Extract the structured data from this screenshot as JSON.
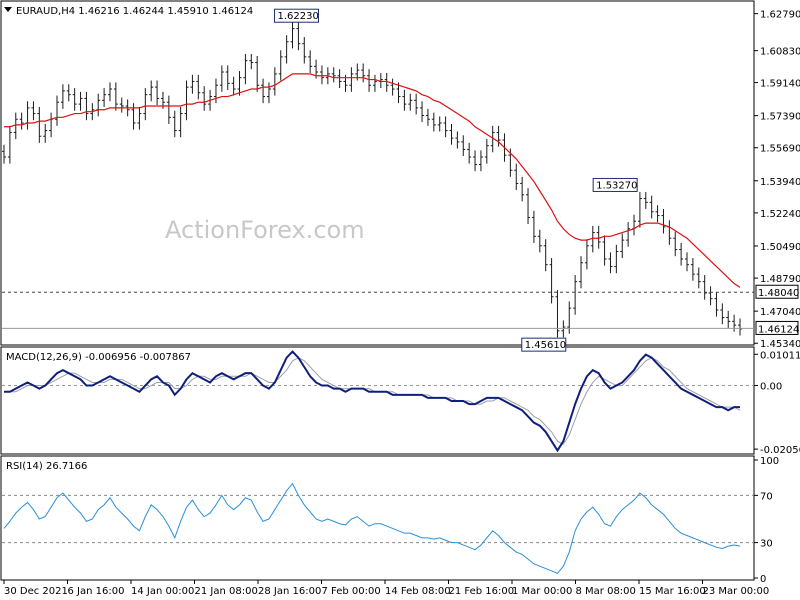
{
  "chart_data": [
    {
      "type": "candlestick",
      "header": "EURAUD,H4  1.46216 1.46244 1.45910 1.46124",
      "symbol": "EURAUD",
      "timeframe": "H4",
      "last_ohlc": {
        "open": 1.46216,
        "high": 1.46244,
        "low": 1.4591,
        "close": 1.46124
      },
      "watermark": "ActionForex.com",
      "ylim": [
        1.453,
        1.633
      ],
      "y_ticks": [
        "1.62790",
        "1.60830",
        "1.59140",
        "1.57390",
        "1.55690",
        "1.53940",
        "1.52240",
        "1.50490",
        "1.48790",
        "1.47040",
        "1.45340"
      ],
      "price_tags": [
        {
          "label": "1.48040",
          "value": 1.4804,
          "style": "dashed"
        },
        {
          "label": "1.46124",
          "value": 1.46124,
          "style": "solid"
        }
      ],
      "annotations": [
        {
          "label": "1.62230",
          "value": 1.6223,
          "x_fraction": 0.43
        },
        {
          "label": "1.53270",
          "value": 1.5327,
          "x_fraction": 0.863
        },
        {
          "label": "1.45610",
          "value": 1.4561,
          "x_fraction": 0.766
        }
      ],
      "close_series": [
        1.552,
        1.565,
        1.572,
        1.57,
        1.578,
        1.575,
        1.563,
        1.566,
        1.572,
        1.581,
        1.587,
        1.585,
        1.58,
        1.583,
        1.575,
        1.577,
        1.582,
        1.585,
        1.588,
        1.58,
        1.579,
        1.577,
        1.57,
        1.575,
        1.585,
        1.589,
        1.583,
        1.581,
        1.573,
        1.566,
        1.575,
        1.589,
        1.592,
        1.586,
        1.58,
        1.584,
        1.59,
        1.597,
        1.591,
        1.588,
        1.594,
        1.603,
        1.602,
        1.59,
        1.584,
        1.588,
        1.596,
        1.605,
        1.613,
        1.62,
        1.612,
        1.605,
        1.6,
        1.597,
        1.594,
        1.596,
        1.595,
        1.592,
        1.59,
        1.596,
        1.598,
        1.595,
        1.59,
        1.592,
        1.593,
        1.59,
        1.588,
        1.584,
        1.58,
        1.582,
        1.578,
        1.574,
        1.572,
        1.569,
        1.57,
        1.566,
        1.562,
        1.56,
        1.556,
        1.552,
        1.548,
        1.552,
        1.558,
        1.565,
        1.561,
        1.553,
        1.545,
        1.538,
        1.532,
        1.52,
        1.51,
        1.505,
        1.495,
        1.478,
        1.46,
        1.462,
        1.472,
        1.486,
        1.496,
        1.505,
        1.512,
        1.507,
        1.498,
        1.494,
        1.502,
        1.508,
        1.514,
        1.518,
        1.53,
        1.528,
        1.523,
        1.521,
        1.515,
        1.509,
        1.503,
        1.498,
        1.495,
        1.49,
        1.486,
        1.48,
        1.477,
        1.471,
        1.467,
        1.465,
        1.463,
        1.461
      ],
      "ma_series": [
        1.568,
        1.568,
        1.569,
        1.569,
        1.57,
        1.57,
        1.571,
        1.571,
        1.572,
        1.573,
        1.573,
        1.574,
        1.575,
        1.575,
        1.576,
        1.576,
        1.577,
        1.577,
        1.578,
        1.578,
        1.578,
        1.578,
        1.578,
        1.578,
        1.579,
        1.579,
        1.579,
        1.579,
        1.579,
        1.579,
        1.579,
        1.58,
        1.58,
        1.581,
        1.581,
        1.582,
        1.583,
        1.584,
        1.584,
        1.585,
        1.586,
        1.587,
        1.588,
        1.588,
        1.589,
        1.589,
        1.59,
        1.592,
        1.594,
        1.596,
        1.596,
        1.596,
        1.596,
        1.595,
        1.595,
        1.595,
        1.594,
        1.594,
        1.594,
        1.594,
        1.594,
        1.594,
        1.593,
        1.593,
        1.592,
        1.592,
        1.591,
        1.59,
        1.589,
        1.588,
        1.587,
        1.585,
        1.584,
        1.582,
        1.581,
        1.579,
        1.577,
        1.575,
        1.573,
        1.571,
        1.568,
        1.566,
        1.564,
        1.562,
        1.56,
        1.557,
        1.554,
        1.551,
        1.547,
        1.543,
        1.539,
        1.534,
        1.529,
        1.524,
        1.518,
        1.514,
        1.511,
        1.509,
        1.508,
        1.508,
        1.509,
        1.509,
        1.51,
        1.51,
        1.511,
        1.512,
        1.513,
        1.514,
        1.516,
        1.517,
        1.517,
        1.517,
        1.516,
        1.515,
        1.513,
        1.511,
        1.509,
        1.506,
        1.503,
        1.5,
        1.497,
        1.494,
        1.491,
        1.488,
        1.485,
        1.483
      ],
      "x_tick_labels": [
        "30 Dec 2021",
        "6 Jan 16:00",
        "14 Jan 00:00",
        "21 Jan 08:00",
        "28 Jan 16:00",
        "7 Feb 00:00",
        "14 Feb 08:00",
        "21 Feb 16:00",
        "1 Mar 00:00",
        "8 Mar 08:00",
        "15 Mar 16:00",
        "23 Mar 00:00"
      ],
      "grid": false
    },
    {
      "type": "line",
      "header": "MACD(12,26,9) -0.006956 -0.007867",
      "name": "MACD(12,26,9)",
      "last_values": [
        -0.006956,
        -0.007867
      ],
      "y_ticks": [
        "0.010113",
        "0.00",
        "-0.020561"
      ],
      "ylim": [
        -0.0215,
        0.0115
      ],
      "macd_series": [
        -0.002,
        -0.002,
        -0.001,
        0.0,
        0.001,
        0.0,
        -0.001,
        0.0,
        0.002,
        0.004,
        0.005,
        0.004,
        0.003,
        0.002,
        0.0,
        0.0,
        0.001,
        0.002,
        0.003,
        0.002,
        0.001,
        0.0,
        -0.001,
        -0.002,
        0.0,
        0.002,
        0.003,
        0.001,
        0.0,
        -0.003,
        -0.001,
        0.002,
        0.004,
        0.003,
        0.002,
        0.001,
        0.003,
        0.004,
        0.003,
        0.002,
        0.003,
        0.004,
        0.004,
        0.002,
        0.0,
        -0.001,
        0.001,
        0.005,
        0.009,
        0.011,
        0.009,
        0.006,
        0.003,
        0.001,
        0.0,
        0.0,
        -0.001,
        -0.001,
        -0.002,
        -0.001,
        -0.001,
        -0.001,
        -0.002,
        -0.002,
        -0.002,
        -0.002,
        -0.003,
        -0.003,
        -0.003,
        -0.003,
        -0.003,
        -0.003,
        -0.004,
        -0.004,
        -0.004,
        -0.004,
        -0.005,
        -0.005,
        -0.005,
        -0.006,
        -0.006,
        -0.005,
        -0.004,
        -0.004,
        -0.004,
        -0.005,
        -0.006,
        -0.007,
        -0.008,
        -0.01,
        -0.012,
        -0.013,
        -0.015,
        -0.018,
        -0.021,
        -0.018,
        -0.012,
        -0.006,
        -0.001,
        0.003,
        0.005,
        0.004,
        0.001,
        -0.001,
        0.0,
        0.001,
        0.003,
        0.005,
        0.008,
        0.01,
        0.009,
        0.007,
        0.005,
        0.003,
        0.001,
        -0.001,
        -0.002,
        -0.003,
        -0.004,
        -0.005,
        -0.006,
        -0.007,
        -0.007,
        -0.008,
        -0.007,
        -0.007
      ],
      "signal_series": [
        -0.002,
        -0.002,
        -0.002,
        -0.001,
        0.0,
        0.0,
        0.0,
        0.0,
        0.001,
        0.002,
        0.003,
        0.004,
        0.004,
        0.003,
        0.002,
        0.001,
        0.001,
        0.001,
        0.002,
        0.002,
        0.002,
        0.001,
        0.0,
        -0.001,
        -0.001,
        0.0,
        0.001,
        0.001,
        0.001,
        -0.001,
        -0.001,
        0.0,
        0.002,
        0.003,
        0.003,
        0.002,
        0.002,
        0.003,
        0.003,
        0.003,
        0.003,
        0.003,
        0.004,
        0.003,
        0.002,
        0.001,
        0.001,
        0.003,
        0.005,
        0.008,
        0.009,
        0.008,
        0.006,
        0.004,
        0.002,
        0.001,
        0.0,
        -0.001,
        -0.001,
        -0.001,
        -0.001,
        -0.001,
        -0.001,
        -0.002,
        -0.002,
        -0.002,
        -0.002,
        -0.003,
        -0.003,
        -0.003,
        -0.003,
        -0.003,
        -0.003,
        -0.004,
        -0.004,
        -0.004,
        -0.004,
        -0.005,
        -0.005,
        -0.005,
        -0.006,
        -0.006,
        -0.005,
        -0.005,
        -0.004,
        -0.004,
        -0.005,
        -0.006,
        -0.007,
        -0.008,
        -0.01,
        -0.011,
        -0.013,
        -0.015,
        -0.018,
        -0.019,
        -0.016,
        -0.011,
        -0.006,
        -0.002,
        0.001,
        0.003,
        0.002,
        0.001,
        0.0,
        0.0,
        0.002,
        0.004,
        0.006,
        0.008,
        0.009,
        0.008,
        0.006,
        0.005,
        0.003,
        0.001,
        -0.001,
        -0.002,
        -0.003,
        -0.004,
        -0.005,
        -0.006,
        -0.007,
        -0.007,
        -0.007,
        -0.008
      ]
    },
    {
      "type": "line",
      "header": "RSI(14) 26.7166",
      "name": "RSI(14)",
      "last_value": 26.7166,
      "y_ticks": [
        "100",
        "70",
        "30",
        "0"
      ],
      "ylim": [
        0,
        100
      ],
      "levels": [
        70,
        30
      ],
      "rsi_series": [
        42,
        48,
        55,
        60,
        64,
        58,
        50,
        52,
        60,
        68,
        72,
        66,
        60,
        55,
        48,
        50,
        58,
        62,
        68,
        60,
        55,
        50,
        44,
        40,
        52,
        62,
        58,
        52,
        44,
        34,
        48,
        60,
        66,
        58,
        52,
        55,
        62,
        70,
        62,
        58,
        62,
        68,
        66,
        56,
        48,
        50,
        58,
        66,
        74,
        80,
        70,
        62,
        56,
        50,
        48,
        50,
        48,
        46,
        45,
        50,
        52,
        48,
        44,
        46,
        46,
        44,
        42,
        40,
        38,
        38,
        36,
        34,
        34,
        33,
        34,
        32,
        30,
        30,
        28,
        26,
        24,
        28,
        34,
        40,
        36,
        30,
        26,
        22,
        20,
        16,
        12,
        10,
        8,
        6,
        4,
        10,
        22,
        40,
        50,
        56,
        60,
        54,
        46,
        44,
        52,
        58,
        62,
        66,
        72,
        68,
        62,
        58,
        54,
        48,
        42,
        38,
        36,
        34,
        32,
        30,
        28,
        26,
        25,
        27,
        28,
        27
      ],
      "x_tick_labels": [
        "30 Dec 2021",
        "6 Jan 16:00",
        "14 Jan 00:00",
        "21 Jan 08:00",
        "28 Jan 16:00",
        "7 Feb 00:00",
        "14 Feb 08:00",
        "21 Feb 16:00",
        "1 Mar 00:00",
        "8 Mar 08:00",
        "15 Mar 16:00",
        "23 Mar 00:00"
      ]
    }
  ],
  "colors": {
    "candle": "#1a1a1a",
    "ma": "#dd1111",
    "macd": "#10207a",
    "signal": "#9aa0a8",
    "rsi": "#2a8fd8",
    "level": "#888888",
    "watermark": "#c8c8c8"
  }
}
